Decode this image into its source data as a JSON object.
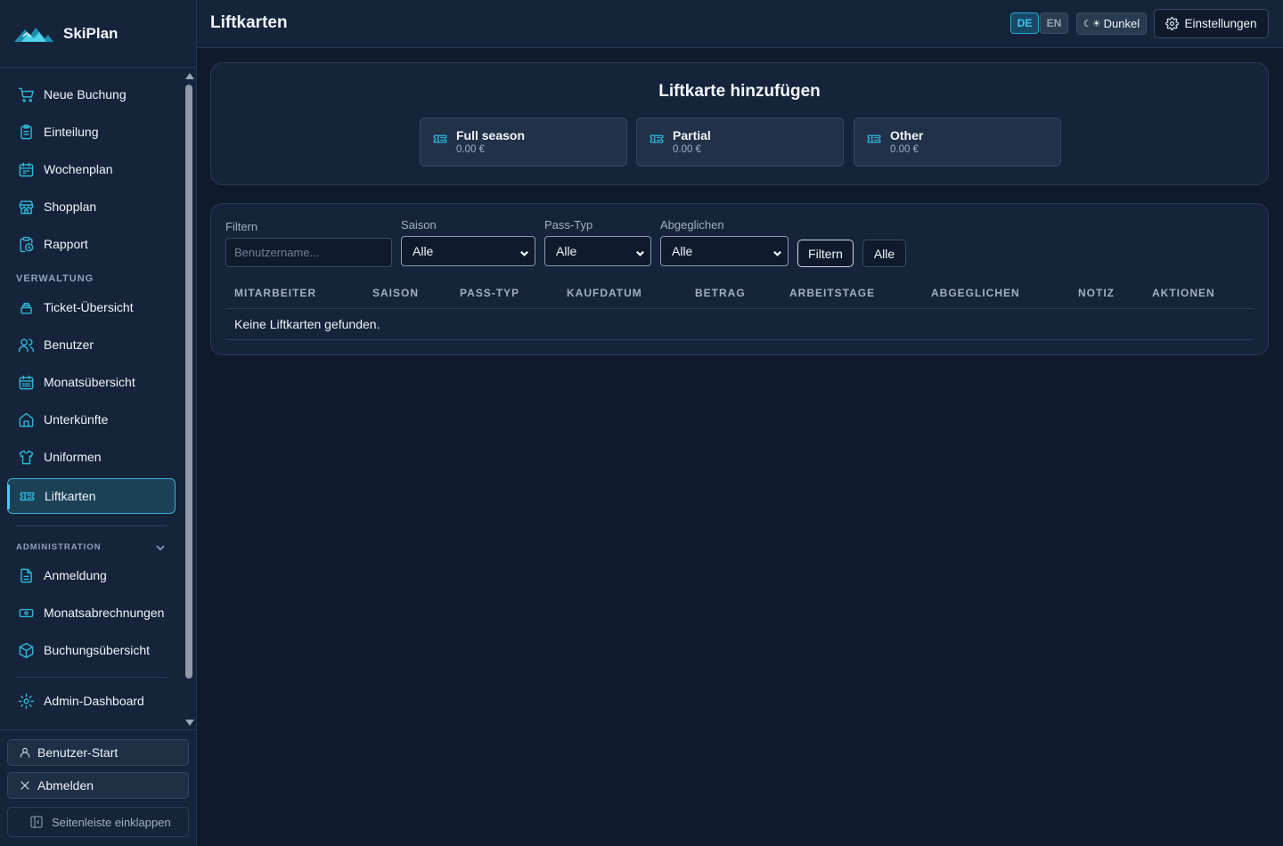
{
  "app": {
    "name": "SkiPlan"
  },
  "sidebar": {
    "items_main": [
      {
        "label": "Neue Buchung",
        "icon": "cart-icon"
      },
      {
        "label": "Einteilung",
        "icon": "clipboard-icon"
      },
      {
        "label": "Wochenplan",
        "icon": "calendar-icon"
      },
      {
        "label": "Shopplan",
        "icon": "store-icon"
      },
      {
        "label": "Rapport",
        "icon": "clipboard-clock-icon"
      }
    ],
    "section_admin_title": "VERWALTUNG",
    "items_admin": [
      {
        "label": "Ticket-Übersicht",
        "icon": "stack-icon"
      },
      {
        "label": "Benutzer",
        "icon": "users-icon"
      },
      {
        "label": "Monatsübersicht",
        "icon": "calendar-grid-icon"
      },
      {
        "label": "Unterkünfte",
        "icon": "home-icon"
      },
      {
        "label": "Uniformen",
        "icon": "shirt-icon"
      },
      {
        "label": "Liftkarten",
        "icon": "ticket-icon",
        "active": true
      }
    ],
    "section_administration_title": "ADMINISTRATION",
    "items_administration": [
      {
        "label": "Anmeldung",
        "icon": "document-icon"
      },
      {
        "label": "Monatsabrechnungen",
        "icon": "banknote-icon"
      },
      {
        "label": "Buchungsübersicht",
        "icon": "box-icon"
      }
    ],
    "admin_dashboard": {
      "label": "Admin-Dashboard",
      "icon": "gear-icon"
    },
    "user_start": "Benutzer-Start",
    "logout": "Abmelden",
    "collapse": "Seitenleiste einklappen"
  },
  "header": {
    "title": "Liftkarten",
    "lang_de": "DE",
    "lang_en": "EN",
    "theme": "Dunkel",
    "theme_icon": "☾☀",
    "settings": "Einstellungen"
  },
  "add_card": {
    "title": "Liftkarte hinzufügen",
    "options": [
      {
        "name": "Full season",
        "price": "0.00 €"
      },
      {
        "name": "Partial",
        "price": "0.00 €"
      },
      {
        "name": "Other",
        "price": "0.00 €"
      }
    ]
  },
  "filters": {
    "filter_label": "Filtern",
    "filter_placeholder": "Benutzername...",
    "saison_label": "Saison",
    "saison_value": "Alle",
    "pass_label": "Pass-Typ",
    "pass_value": "Alle",
    "abgeglichen_label": "Abgeglichen",
    "abgeglichen_value": "Alle",
    "filter_button": "Filtern",
    "all_button": "Alle"
  },
  "table": {
    "columns": [
      "MITARBEITER",
      "SAISON",
      "PASS-TYP",
      "KAUFDATUM",
      "BETRAG",
      "ARBEITSTAGE",
      "ABGEGLICHEN",
      "NOTIZ",
      "AKTIONEN"
    ],
    "empty_text": "Keine Liftkarten gefunden."
  },
  "colors": {
    "accent": "#2fb6d9",
    "background": "#0f1a2d",
    "panel": "#15243a"
  }
}
